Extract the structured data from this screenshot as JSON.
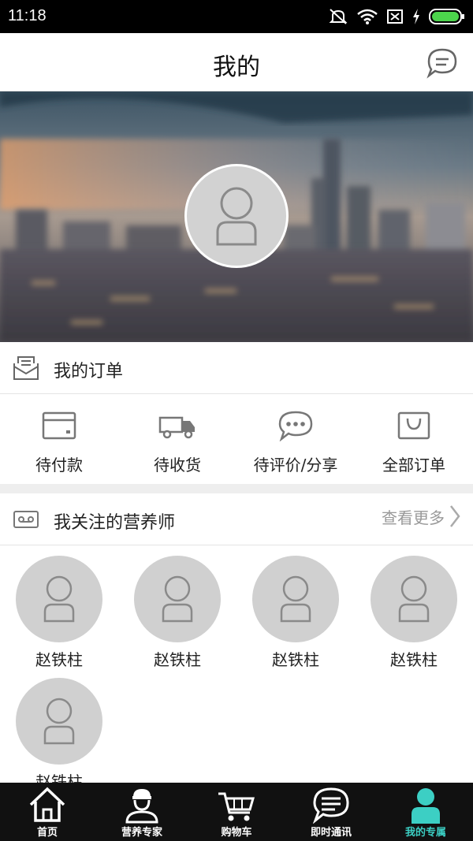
{
  "status_bar": {
    "time": "11:18"
  },
  "header": {
    "title": "我的"
  },
  "orders_section": {
    "title": "我的订单",
    "items": [
      {
        "label": "待付款",
        "icon": "card-icon"
      },
      {
        "label": "待收货",
        "icon": "truck-icon"
      },
      {
        "label": "待评价/分享",
        "icon": "chat-bubble-icon"
      },
      {
        "label": "全部订单",
        "icon": "bag-icon"
      }
    ]
  },
  "nutritionist_section": {
    "title": "我关注的营养师",
    "more_label": "查看更多",
    "items": [
      {
        "name": "赵铁柱"
      },
      {
        "name": "赵铁柱"
      },
      {
        "name": "赵铁柱"
      },
      {
        "name": "赵铁柱"
      },
      {
        "name": "赵铁柱"
      }
    ]
  },
  "bottom_nav": {
    "items": [
      {
        "label": "首页",
        "icon": "home-icon"
      },
      {
        "label": "营养专家",
        "icon": "expert-icon"
      },
      {
        "label": "购物车",
        "icon": "cart-icon"
      },
      {
        "label": "即时通讯",
        "icon": "message-icon"
      },
      {
        "label": "我的专属",
        "icon": "profile-icon"
      }
    ],
    "active_index": 4
  },
  "colors": {
    "accent": "#3ccfc4",
    "nav_bg": "#111111",
    "status_bg": "#000000"
  }
}
